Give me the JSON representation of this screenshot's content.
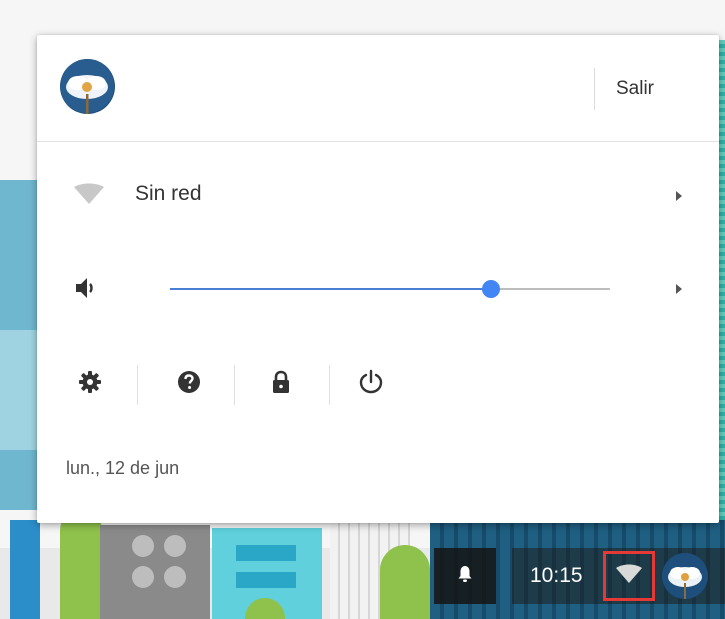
{
  "tray": {
    "signout_label": "Salir",
    "network": {
      "label": "Sin red",
      "icon": "wifi-icon"
    },
    "volume": {
      "icon": "speaker-icon",
      "level": 0.73,
      "accent": "#4285f4"
    },
    "actions": [
      {
        "name": "settings",
        "icon": "gear-icon"
      },
      {
        "name": "help",
        "icon": "help-icon"
      },
      {
        "name": "lock",
        "icon": "lock-icon"
      },
      {
        "name": "power",
        "icon": "power-icon"
      }
    ],
    "date": "lun., 12 de jun"
  },
  "shelf": {
    "time": "10:15",
    "notification_icon": "bell-icon",
    "highlight_color": "#e53935"
  }
}
